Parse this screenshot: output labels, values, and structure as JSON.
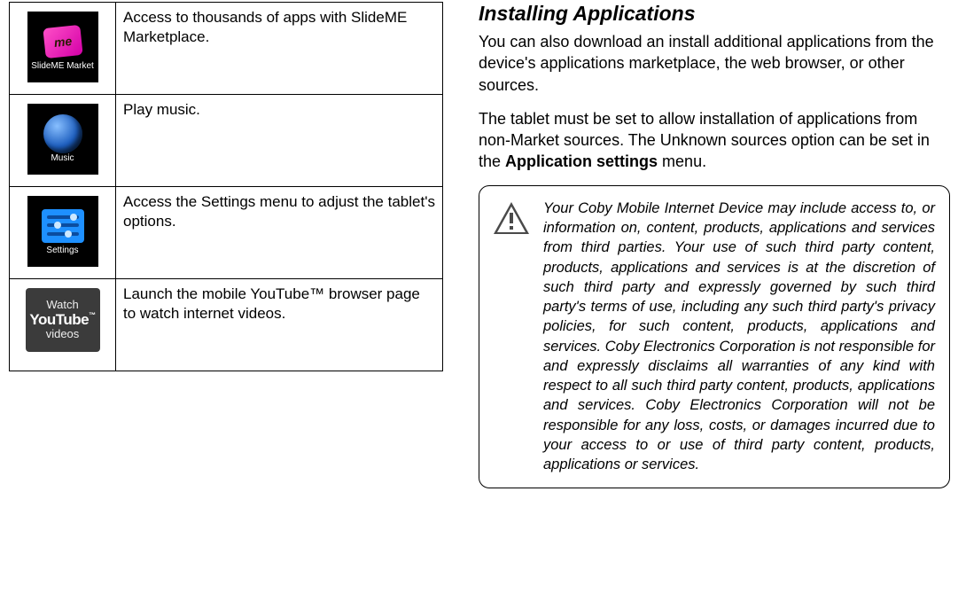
{
  "apps_table": {
    "rows": [
      {
        "icon_name": "slideme-market-icon",
        "icon_label": "SlideME Market",
        "desc": "Access to thousands of apps with SlideME Marketplace."
      },
      {
        "icon_name": "music-icon",
        "icon_label": "Music",
        "desc": "Play music."
      },
      {
        "icon_name": "settings-icon",
        "icon_label": "Settings",
        "desc": "Access the Settings menu to adjust the tablet's options."
      },
      {
        "icon_name": "youtube-icon",
        "icon_label_top": "Watch",
        "icon_label_mid": "YouTube",
        "icon_label_tm": "™",
        "icon_label_bot": "videos",
        "desc": "Launch the mobile YouTube™ browser page to watch internet videos."
      }
    ]
  },
  "installing": {
    "heading": "Installing Applications",
    "para1": "You can also download an install additional applications from the device's applications marketplace, the web browser, or other sources.",
    "para2_pre": "The tablet must be set to allow installation of applications from non-Market sources. The Unknown sources option can be set in the ",
    "para2_bold": "Application settings",
    "para2_post": " menu.",
    "warning": "Your Coby Mobile Internet Device may include access to, or information on, content, products, applications and services from third parties. Your use of such third party content, products, applications and services is at the discretion of such third party and expressly governed by such third party's terms of use, including any such third party's privacy policies, for such content, products, applications and services. Coby Electronics Corporation is not responsible for and expressly disclaims all warranties of any kind with respect to all such third party content, products, applications and services. Coby Electronics Corporation will not be responsible for any loss, costs, or damages incurred due to your access to or use of third party content, products, applications or services."
  },
  "icon_glyphs": {
    "slideme_text": "me"
  }
}
